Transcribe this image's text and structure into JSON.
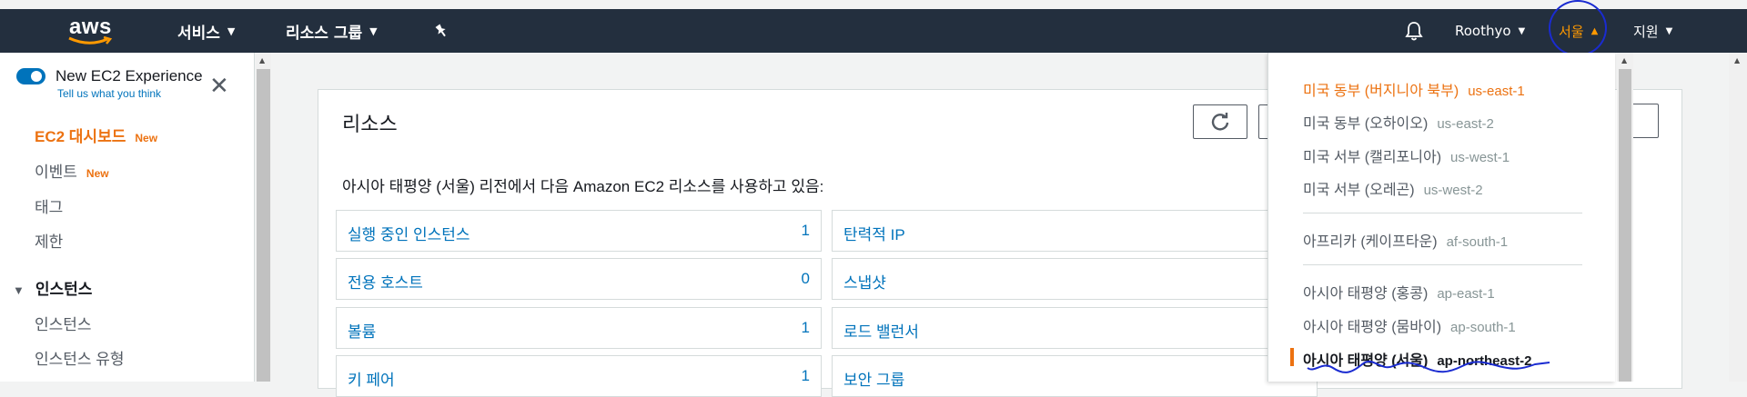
{
  "nav": {
    "logo": "aws",
    "services": "서비스",
    "resource_groups": "리소스 그룹",
    "user": "Roothyo",
    "region": "서울",
    "support": "지원"
  },
  "sidebar": {
    "experience_title": "New EC2 Experience",
    "experience_feedback": "Tell us what you think",
    "items": [
      {
        "label": "EC2 대시보드",
        "badge": "New"
      },
      {
        "label": "이벤트",
        "badge": "New"
      },
      {
        "label": "태그"
      },
      {
        "label": "제한"
      }
    ],
    "section": "인스턴스",
    "section_items": [
      "인스턴스",
      "인스턴스 유형"
    ]
  },
  "main": {
    "title": "리소스",
    "description": "아시아 태평양 (서울) 리전에서 다음 Amazon EC2 리소스를 사용하고 있음:",
    "resources_left": [
      {
        "label": "실행 중인 인스턴스",
        "count": "1"
      },
      {
        "label": "전용 호스트",
        "count": "0"
      },
      {
        "label": "볼륨",
        "count": "1"
      },
      {
        "label": "키 페어",
        "count": "1"
      }
    ],
    "resources_right": [
      {
        "label": "탄력적 IP"
      },
      {
        "label": "스냅샷"
      },
      {
        "label": "로드 밸런서"
      },
      {
        "label": "보안 그룹"
      }
    ]
  },
  "region_menu": [
    {
      "name": "미국 동부 (버지니아 북부)",
      "code": "us-east-1"
    },
    {
      "name": "미국 동부 (오하이오)",
      "code": "us-east-2"
    },
    {
      "name": "미국 서부 (캘리포니아)",
      "code": "us-west-1"
    },
    {
      "name": "미국 서부 (오레곤)",
      "code": "us-west-2"
    },
    {
      "name": "아프리카 (케이프타운)",
      "code": "af-south-1"
    },
    {
      "name": "아시아 태평양 (홍콩)",
      "code": "ap-east-1"
    },
    {
      "name": "아시아 태평양 (뭄바이)",
      "code": "ap-south-1"
    },
    {
      "name": "아시아 태평양 (서울)",
      "code": "ap-northeast-2"
    }
  ],
  "colors": {
    "nav_bg": "#232f3e",
    "accent_orange": "#ec7211",
    "link_blue": "#0073bb",
    "annotation_blue": "#1a2bd1"
  }
}
